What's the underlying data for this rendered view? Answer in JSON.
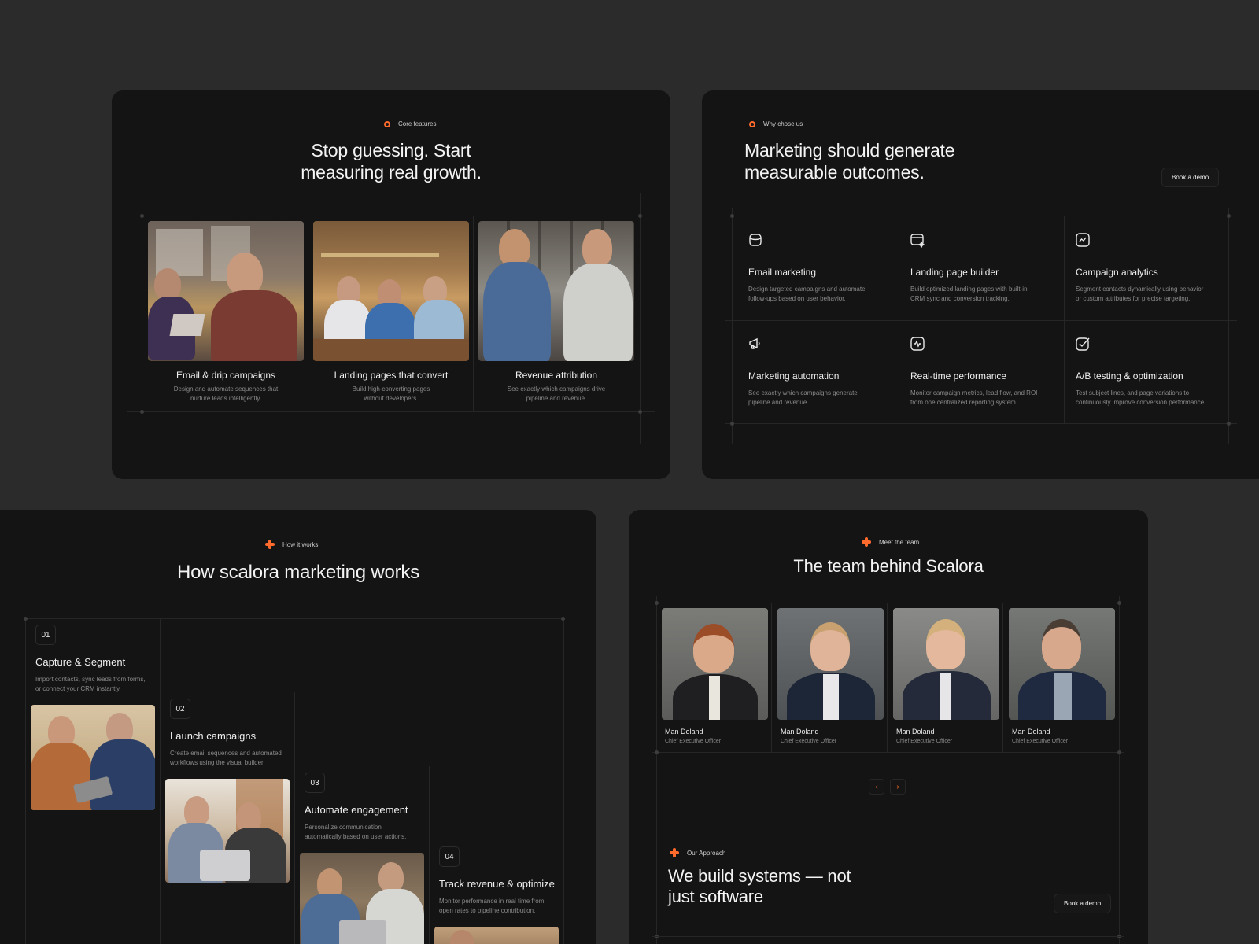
{
  "features_panel": {
    "tag": "Core features",
    "heading_line1": "Stop guessing. Start",
    "heading_line2": "measuring real growth.",
    "cards": [
      {
        "title": "Email & drip campaigns",
        "desc_line1": "Design and automate sequences that",
        "desc_line2": "nurture leads intelligently."
      },
      {
        "title": "Landing pages that convert",
        "desc_line1": "Build high-converting pages",
        "desc_line2": "without developers."
      },
      {
        "title": "Revenue attribution",
        "desc_line1": "See exactly which campaigns drive",
        "desc_line2": "pipeline and revenue."
      }
    ]
  },
  "why_panel": {
    "tag": "Why chose us",
    "heading_line1": "Marketing should generate",
    "heading_line2": "measurable outcomes.",
    "cta": "Book a demo",
    "cells": [
      {
        "icon": "database-icon",
        "title": "Email marketing",
        "desc_line1": "Design targeted campaigns and automate",
        "desc_line2": "follow-ups based on user behavior."
      },
      {
        "icon": "browser-sparkle-icon",
        "title": "Landing page builder",
        "desc_line1": "Build optimized landing pages with built-in",
        "desc_line2": "CRM sync and conversion tracking."
      },
      {
        "icon": "chart-line-icon",
        "title": "Campaign analytics",
        "desc_line1": "Segment contacts dynamically using behavior",
        "desc_line2": "or custom attributes for precise targeting."
      },
      {
        "icon": "megaphone-icon",
        "title": "Marketing automation",
        "desc_line1": "See exactly which campaigns generate",
        "desc_line2": "pipeline and revenue."
      },
      {
        "icon": "pulse-icon",
        "title": "Real-time performance",
        "desc_line1": "Monitor campaign metrics, lead flow, and ROI",
        "desc_line2": "from one centralized reporting system."
      },
      {
        "icon": "checkbox-icon",
        "title": "A/B testing & optimization",
        "desc_line1": "Test subject lines, and page variations to",
        "desc_line2": "continuously improve conversion performance."
      }
    ]
  },
  "how_panel": {
    "tag": "How it works",
    "heading": "How scalora marketing works",
    "steps": [
      {
        "num": "01",
        "title": "Capture & Segment",
        "desc_line1": "Import contacts, sync leads from forms,",
        "desc_line2": "or connect your CRM instantly."
      },
      {
        "num": "02",
        "title": "Launch campaigns",
        "desc_line1": "Create email sequences and automated",
        "desc_line2": "workflows using the visual builder."
      },
      {
        "num": "03",
        "title": "Automate engagement",
        "desc_line1": "Personalize communication",
        "desc_line2": "automatically based on user actions."
      },
      {
        "num": "04",
        "title": "Track revenue & optimize",
        "desc_line1": "Monitor performance in real time from",
        "desc_line2": "open rates to pipeline contribution."
      }
    ]
  },
  "team_panel": {
    "tag": "Meet the team",
    "heading": "The team behind Scalora",
    "members": [
      {
        "name": "Man Doland",
        "role": "Chief Executive Officer"
      },
      {
        "name": "Man Doland",
        "role": "Chief Executive Officer"
      },
      {
        "name": "Man Doland",
        "role": "Chief Executive Officer"
      },
      {
        "name": "Man Doland",
        "role": "Chief Executive Officer"
      }
    ],
    "prev": "‹",
    "next": "›",
    "approach_tag": "Our Approach",
    "approach_line1": "We build systems — not",
    "approach_line2": "just software",
    "cta": "Book a demo"
  },
  "colors": {
    "accent": "#ff6b2c",
    "background": "#2b2b2b",
    "panel": "#141414"
  }
}
